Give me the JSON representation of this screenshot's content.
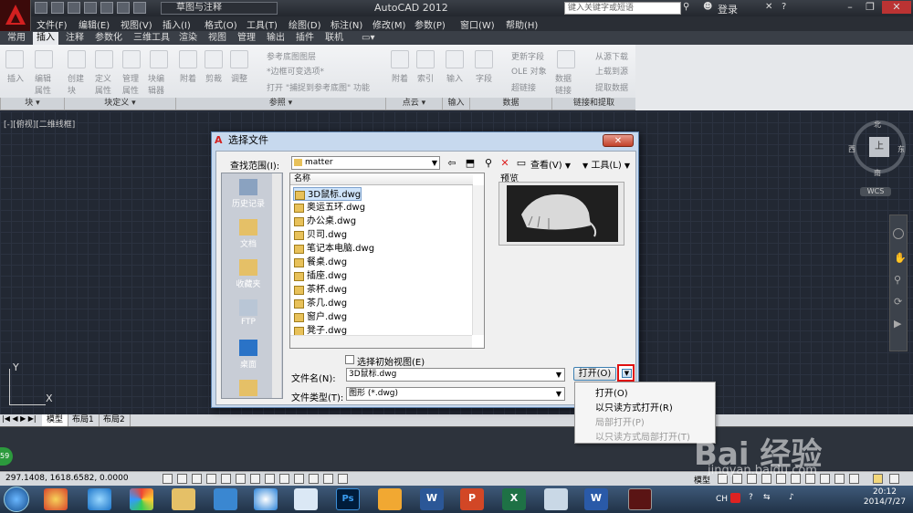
{
  "titlebar": {
    "workspace": "草图与注释",
    "app_title": "AutoCAD 2012",
    "search_placeholder": "键入关键字或短语",
    "login": "登录"
  },
  "menubar": [
    "文件(F)",
    "编辑(E)",
    "视图(V)",
    "插入(I)",
    "格式(O)",
    "工具(T)",
    "绘图(D)",
    "标注(N)",
    "修改(M)",
    "参数(P)",
    "窗口(W)",
    "帮助(H)"
  ],
  "ribbon_tabs": [
    "常用",
    "插入",
    "注释",
    "参数化",
    "三维工具",
    "渲染",
    "视图",
    "管理",
    "输出",
    "插件",
    "联机"
  ],
  "ribbon_active_tab": "插入",
  "ribbon": {
    "block_btns": [
      "插入",
      "编辑属性"
    ],
    "block_def_btns": [
      "创建块",
      "定义属性",
      "管理属性",
      "块编辑器"
    ],
    "ref_btns": [
      "附着",
      "剪裁",
      "调整"
    ],
    "ref_small": [
      "参考底图图层",
      "*边框可变选项*",
      "打开 \"捕捉到参考底图\" 功能"
    ],
    "pointcloud_btns": [
      "附着",
      "索引"
    ],
    "import_btn": "输入",
    "data_btn": "字段",
    "data_small": [
      "更新字段",
      "OLE 对象",
      "超链接"
    ],
    "data_link_btn": "数据链接",
    "link_small": [
      "从源下载",
      "上载到源",
      "提取数据"
    ],
    "panels": [
      "块 ▾",
      "块定义 ▾",
      "参照 ▾",
      "点云 ▾",
      "输入",
      "数据",
      "链接和提取"
    ]
  },
  "viewport_label": "[-][俯视][二维线框]",
  "viewcube": {
    "n": "北",
    "s": "南",
    "e": "东",
    "w": "西",
    "top": "上",
    "wcs": "WCS"
  },
  "ucs": {
    "x": "X",
    "y": "Y"
  },
  "layout_tabs": [
    "模型",
    "布局1",
    "布局2"
  ],
  "status": {
    "coords": "297.1408,  1618.6582, 0.0000",
    "model": "模型"
  },
  "dialog": {
    "title": "选择文件",
    "close": "✕",
    "look_in_label": "查找范围(I):",
    "look_in_value": "matter",
    "view_menu": "查看(V)",
    "tools_menu": "工具(L)",
    "places": [
      "历史记录",
      "文档",
      "收藏夹",
      "FTP",
      "桌面",
      ""
    ],
    "list_header": "名称",
    "files": [
      "3D鼠标.dwg",
      "奥运五环.dwg",
      "办公桌.dwg",
      "贝司.dwg",
      "笔记本电脑.dwg",
      "餐桌.dwg",
      "插座.dwg",
      "茶杯.dwg",
      "茶几.dwg",
      "窗户.dwg",
      "凳子.dwg"
    ],
    "selected_file_index": 0,
    "preview_label": "预览",
    "initial_view_label": "选择初始视图(E)",
    "filename_label": "文件名(N):",
    "filename_value": "3D鼠标.dwg",
    "filetype_label": "文件类型(T):",
    "filetype_value": "图形 (*.dwg)",
    "open_button": "打开(O)",
    "open_dropdown": [
      {
        "label": "打开(O)",
        "enabled": true
      },
      {
        "label": "以只读方式打开(R)",
        "enabled": true
      },
      {
        "label": "局部打开(P)",
        "enabled": false
      },
      {
        "label": "以只读方式局部打开(T)",
        "enabled": false
      }
    ]
  },
  "taskbar": {
    "clock_time": "20:12",
    "clock_date": "2014/7/27",
    "tray_lang": "CH"
  },
  "watermark": {
    "main": "Bai 经验",
    "sub": "jingyan.baidu.com"
  },
  "colors": {
    "accent_red": "#e01010",
    "autocad_red": "#d32020",
    "dialog_frame": "#c7d9ee"
  }
}
